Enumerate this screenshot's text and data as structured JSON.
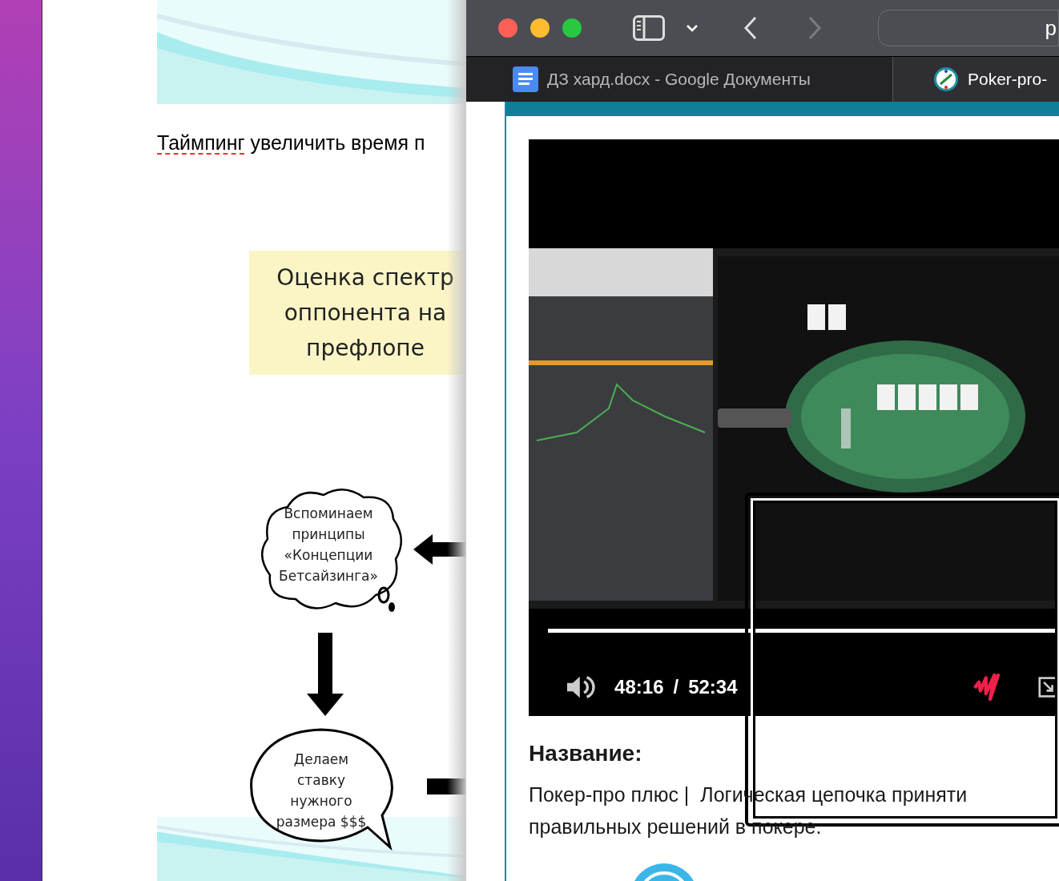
{
  "document": {
    "heading": "Таймпинг увеличить время п",
    "diagram": {
      "box": [
        "Оценка спектр",
        "оппонента на",
        "префлопе"
      ],
      "cloud": [
        "Вспоминаем",
        "принципы",
        "«Концепции",
        "Бетсайзинга»"
      ],
      "bubble": [
        "Делаем",
        "ставку",
        "нужного",
        "размера $$$"
      ]
    }
  },
  "browser": {
    "address": "p",
    "tabs": [
      {
        "title": "ДЗ хард.docx - Google Документы",
        "selected": false
      },
      {
        "title": "Poker-pro-",
        "selected": true
      }
    ],
    "video": {
      "kind": "picture",
      "current_time": "48:16",
      "separator": "/",
      "duration": "52:34",
      "progress": {
        "level": 1
      }
    },
    "heading": "Название:",
    "description": [
      "Покер-про плюс |  Логическая цепочка приняти",
      "правильных решений в покере."
    ]
  }
}
